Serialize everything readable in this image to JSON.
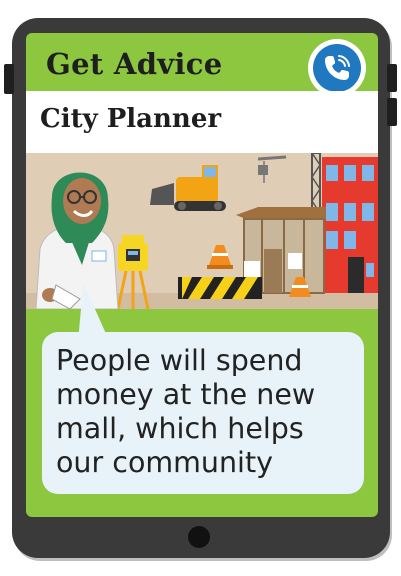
{
  "header": {
    "title": "Get Advice",
    "call_icon": "phone-call-icon"
  },
  "role": {
    "title": "City Planner"
  },
  "scene": {
    "description_icons": [
      "city-planner-avatar",
      "bulldozer-icon",
      "crane-icon",
      "surveying-instrument-icon",
      "traffic-cone-icon",
      "barrier-icon",
      "house-under-construction-icon",
      "red-building-icon"
    ]
  },
  "advice": {
    "text": "People will spend money at the new mall, which helps our community"
  },
  "colors": {
    "screen_green": "#8dc63f",
    "call_blue": "#1f78c0",
    "bubble_bg": "#e7f3f8",
    "frame": "#3a3a3a"
  }
}
